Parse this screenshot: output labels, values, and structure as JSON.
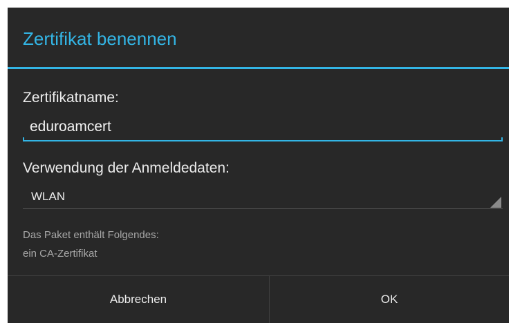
{
  "dialog": {
    "title": "Zertifikat benennen",
    "accent_color": "#33b5e5",
    "background_color": "#282828"
  },
  "certificate_name": {
    "label": "Zertifikatname:",
    "value": "eduroamcert"
  },
  "credential_usage": {
    "label": "Verwendung der Anmeldedaten:",
    "selected": "WLAN"
  },
  "package_info": {
    "line1": "Das Paket enthält Folgendes:",
    "line2": "ein CA-Zertifikat"
  },
  "buttons": {
    "cancel_label": "Abbrechen",
    "ok_label": "OK"
  }
}
